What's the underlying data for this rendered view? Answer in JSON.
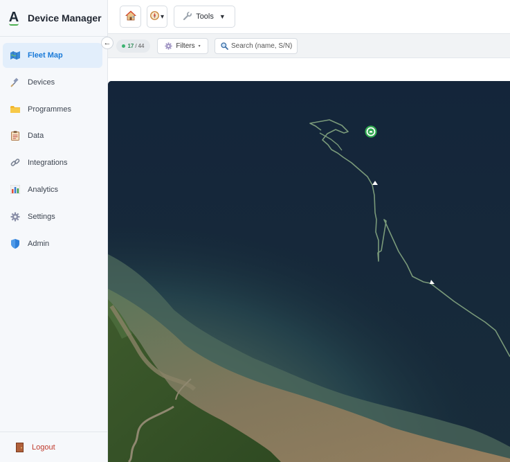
{
  "app": {
    "title": "Device Manager",
    "logo_letter": "A"
  },
  "sidebar": {
    "items": [
      {
        "label": "Fleet Map",
        "icon": "map-icon",
        "active": true
      },
      {
        "label": "Devices",
        "icon": "satellite-icon",
        "active": false
      },
      {
        "label": "Programmes",
        "icon": "folder-icon",
        "active": false
      },
      {
        "label": "Data",
        "icon": "clipboard-icon",
        "active": false
      },
      {
        "label": "Integrations",
        "icon": "link-icon",
        "active": false
      },
      {
        "label": "Analytics",
        "icon": "bar-chart-icon",
        "active": false
      },
      {
        "label": "Settings",
        "icon": "gear-icon",
        "active": false
      },
      {
        "label": "Admin",
        "icon": "shield-icon",
        "active": false
      }
    ],
    "logout_label": "Logout",
    "collapse_glyph": "←"
  },
  "toolbar": {
    "tools_label": "Tools",
    "tools_caret": "▼",
    "compass_caret": "▾"
  },
  "filterbar": {
    "online_count": "17",
    "count_separator": "/",
    "total_count": "44",
    "filters_label": "Filters",
    "filters_caret": "▾",
    "search_placeholder": "Search (name, S/N)"
  },
  "colors": {
    "accent": "#1a7ad8",
    "active_bg": "#e2eefb",
    "online": "#3cb371",
    "logout": "#c0392b",
    "ocean": "#152636",
    "track": "#7a9a7a",
    "device_marker": "#2fa84f"
  }
}
